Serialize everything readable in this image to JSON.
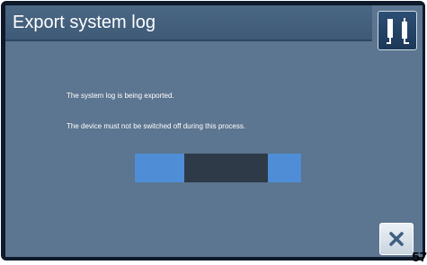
{
  "dialog": {
    "title": "Export system log",
    "message_line1": "The system log is being exported.",
    "message_line2": "The device must not be switched off during this process."
  },
  "progress": {
    "indeterminate": true
  },
  "buttons": {
    "tools_icon": "tools-icon",
    "cancel_icon": "close-icon"
  },
  "page_number": "57",
  "colors": {
    "background": "#5c7590",
    "title_bar": "#4a6784",
    "progress_fill": "#4f8ed6",
    "progress_indicator": "#2f3a48"
  }
}
